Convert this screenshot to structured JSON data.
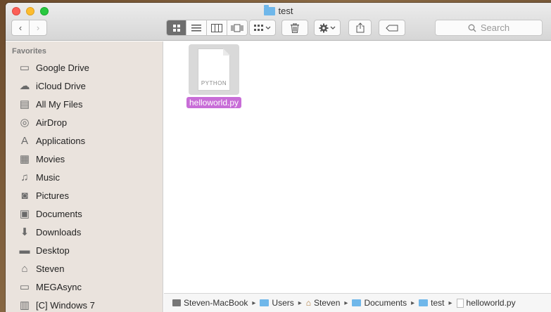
{
  "window": {
    "title": "test"
  },
  "toolbar": {
    "back_label": "‹",
    "forward_label": "›",
    "search_placeholder": "Search"
  },
  "sidebar": {
    "heading": "Favorites",
    "items": [
      {
        "label": "Google Drive",
        "icon": "folder-icon"
      },
      {
        "label": "iCloud Drive",
        "icon": "cloud-icon"
      },
      {
        "label": "All My Files",
        "icon": "files-icon"
      },
      {
        "label": "AirDrop",
        "icon": "airdrop-icon"
      },
      {
        "label": "Applications",
        "icon": "applications-icon"
      },
      {
        "label": "Movies",
        "icon": "film-icon"
      },
      {
        "label": "Music",
        "icon": "music-icon"
      },
      {
        "label": "Pictures",
        "icon": "camera-icon"
      },
      {
        "label": "Documents",
        "icon": "documents-icon"
      },
      {
        "label": "Downloads",
        "icon": "download-icon"
      },
      {
        "label": "Desktop",
        "icon": "desktop-icon"
      },
      {
        "label": "Steven",
        "icon": "home-icon"
      },
      {
        "label": "MEGAsync",
        "icon": "folder-icon"
      },
      {
        "label": "[C] Windows 7",
        "icon": "drive-icon"
      }
    ]
  },
  "main": {
    "file": {
      "name": "helloworld.py",
      "type_label": "PYTHON"
    }
  },
  "pathbar": {
    "crumbs": [
      "Steven-MacBook",
      "Users",
      "Steven",
      "Documents",
      "test",
      "helloworld.py"
    ]
  },
  "colors": {
    "selection": "#c86dd7",
    "folder": "#6fb7ea",
    "sidebar_bg": "#eae3dd"
  }
}
